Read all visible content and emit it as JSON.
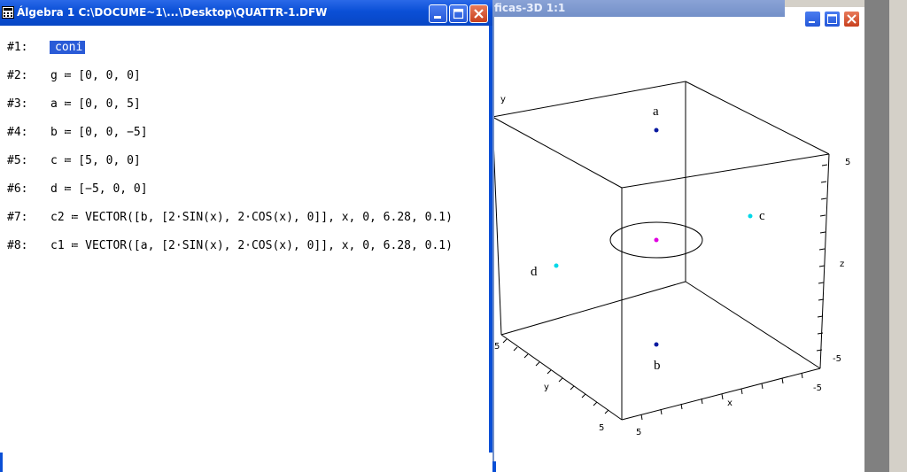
{
  "algebra_window": {
    "title": "Álgebra 1  C:\\DOCUME~1\\...\\Desktop\\QUATTR-1.DFW",
    "expressions": [
      {
        "num": "#1:",
        "text": "coni",
        "selected": true
      },
      {
        "num": "#2:",
        "text": "g ≔ [0, 0, 0]"
      },
      {
        "num": "#3:",
        "text": "a ≔ [0, 0, 5]"
      },
      {
        "num": "#4:",
        "text": "b ≔ [0, 0, −5]"
      },
      {
        "num": "#5:",
        "text": "c ≔ [5, 0, 0]"
      },
      {
        "num": "#6:",
        "text": "d ≔ [−5, 0, 0]"
      },
      {
        "num": "#7:",
        "text": "c2 ≔ VECTOR([b, [2·SIN(x), 2·COS(x), 0]], x, 0, 6.28, 0.1)"
      },
      {
        "num": "#8:",
        "text": "c1 ≔ VECTOR([a, [2·SIN(x), 2·COS(x), 0]], x, 0, 6.28, 0.1)"
      }
    ]
  },
  "graphics_window": {
    "title": "ficas-3D 1:1",
    "axis_labels": {
      "y_top": "y",
      "y_bottom": "y",
      "x": "x",
      "z": "z"
    },
    "tick_labels": {
      "z_max": "5",
      "z_min": "-5",
      "y_near": "5",
      "y_far": "5",
      "x_near": "5",
      "x_far": "-5"
    },
    "points": [
      {
        "label": "a",
        "color": "#0a1aa0"
      },
      {
        "label": "b",
        "color": "#0a1aa0"
      },
      {
        "label": "c",
        "color": "#00d8e8"
      },
      {
        "label": "d",
        "color": "#00d8e8"
      },
      {
        "label": "",
        "color": "#e000e0"
      }
    ]
  },
  "colors": {
    "titlebar_active": "#0a4fd6",
    "titlebar_inactive": "#7390c8",
    "selection": "#2a5bd7"
  }
}
